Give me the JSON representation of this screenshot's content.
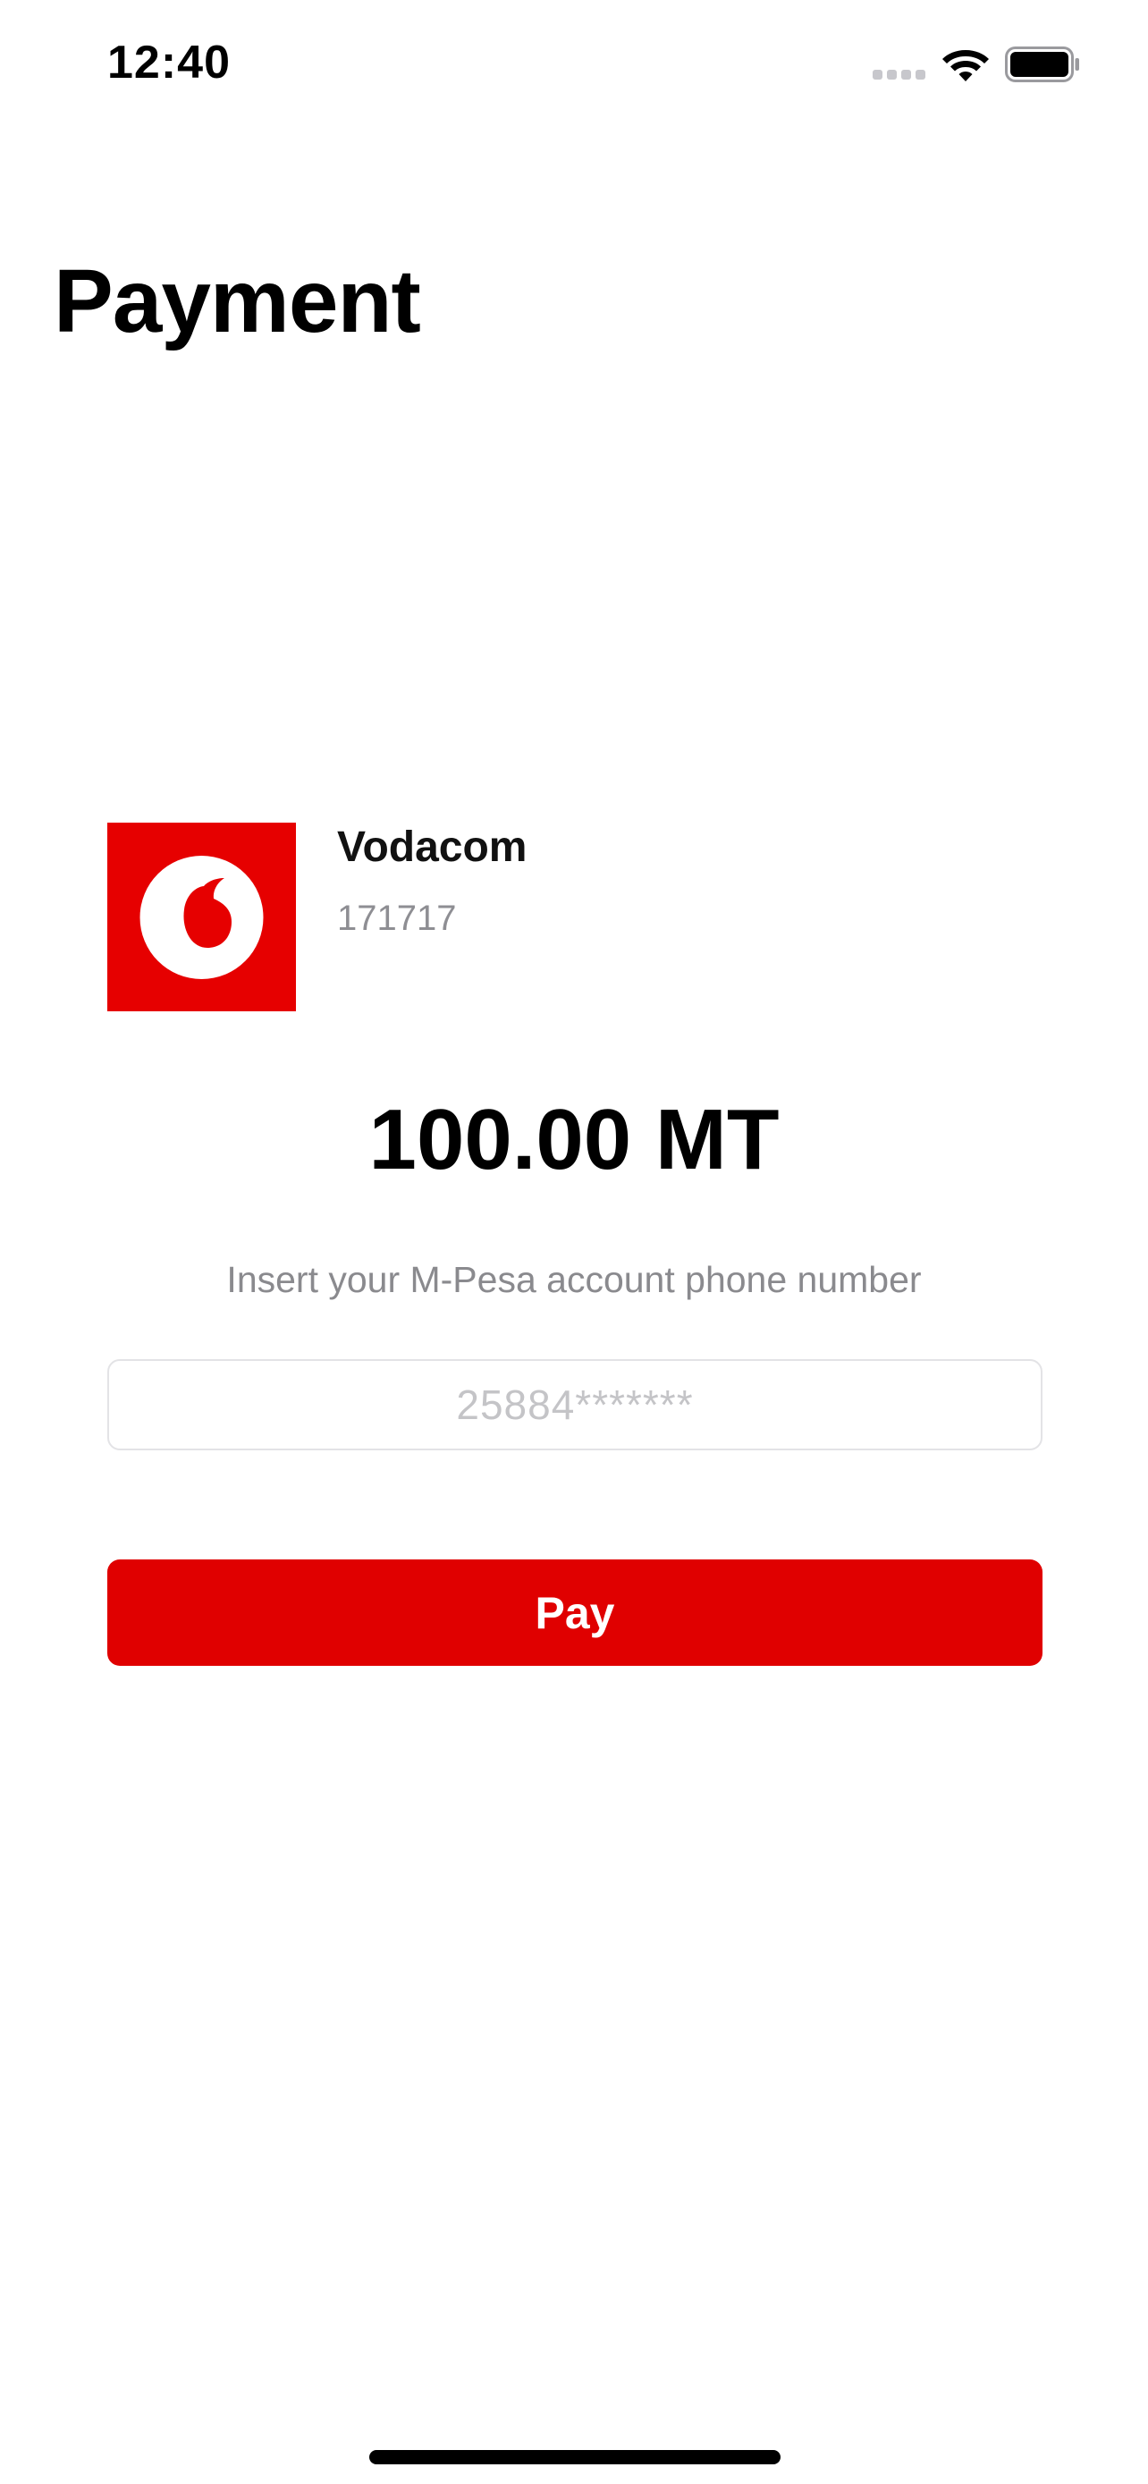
{
  "status_bar": {
    "time": "12:40",
    "icons": [
      "signal-dots-icon",
      "wifi-icon",
      "battery-icon"
    ]
  },
  "page": {
    "title": "Payment"
  },
  "merchant": {
    "name": "Vodacom",
    "code": "171717",
    "logo": "vodacom-logo",
    "brand_color": "#e60000"
  },
  "payment": {
    "amount": "100.00 MT",
    "instruction": "Insert your M-Pesa account phone number",
    "phone_placeholder": "25884*******",
    "phone_value": "",
    "pay_label": "Pay",
    "pay_color": "#e00000"
  }
}
